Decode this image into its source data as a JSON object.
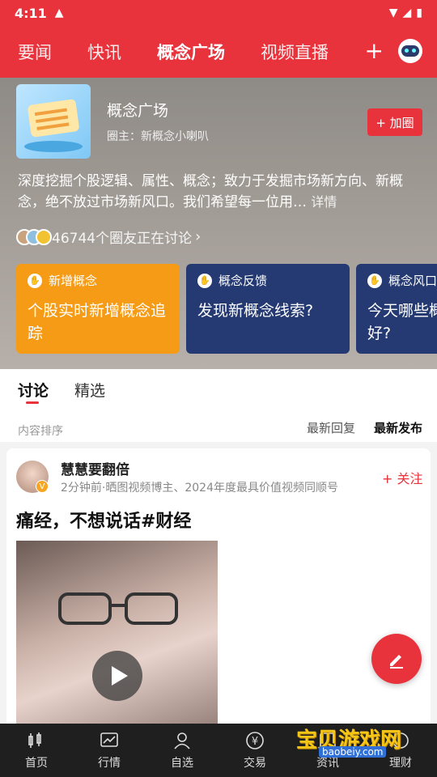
{
  "status": {
    "time": "4:11"
  },
  "topnav": {
    "tabs": [
      "要闻",
      "快讯",
      "概念广场",
      "视频直播"
    ],
    "active": 2,
    "plus": "+"
  },
  "hero": {
    "title": "概念广场",
    "owner": "圈主：新概念小喇叭",
    "join_label": "+ 加圈",
    "description": "深度挖掘个股逻辑、属性、概念；致力于发掘市场新方向、新概念，绝不放过市场新风口。我们希望每一位用…",
    "more": "详情",
    "members": "46744个圈友正在讨论",
    "cards": [
      {
        "tag": "新增概念",
        "body": "个股实时新增概念追踪",
        "color": "orange"
      },
      {
        "tag": "概念反馈",
        "body": "发现新概念线索?",
        "color": "navy"
      },
      {
        "tag": "概念风口",
        "body": "今天哪些概念表现好?",
        "color": "navy"
      }
    ]
  },
  "content_tabs": [
    "讨论",
    "精选"
  ],
  "sort": {
    "label": "内容排序",
    "options": [
      "最新回复",
      "最新发布"
    ],
    "active": 1
  },
  "post": {
    "author": "慧慧要翻倍",
    "meta": "2分钟前·晒图视频博主、2024年度最具价值视频同顺号",
    "follow": "+ 关注",
    "text": "痛经，不想说话#财经"
  },
  "bottomnav": [
    "首页",
    "行情",
    "自选",
    "交易",
    "资讯",
    "理财"
  ],
  "watermark": {
    "text": "宝贝游戏网",
    "url": "baobeiy.com"
  },
  "colors": {
    "brand": "#e8323c",
    "orange": "#f59b15",
    "navy": "#253a72"
  }
}
